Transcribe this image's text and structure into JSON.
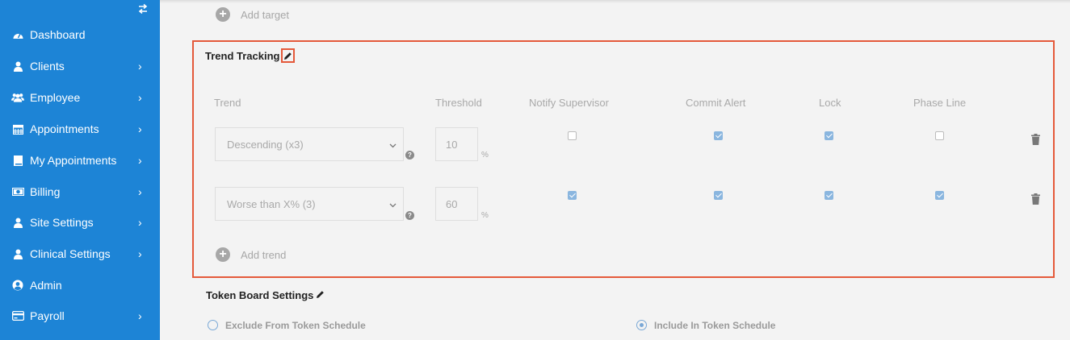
{
  "sidebar": {
    "toggle_icon": "swap-arrows-icon",
    "items": [
      {
        "label": "Dashboard",
        "icon": "tachometer-icon",
        "has_chevron": false
      },
      {
        "label": "Clients",
        "icon": "user-icon",
        "has_chevron": true
      },
      {
        "label": "Employee",
        "icon": "users-icon",
        "has_chevron": true
      },
      {
        "label": "Appointments",
        "icon": "calendar-icon",
        "has_chevron": true
      },
      {
        "label": "My Appointments",
        "icon": "book-icon",
        "has_chevron": true
      },
      {
        "label": "Billing",
        "icon": "money-icon",
        "has_chevron": true
      },
      {
        "label": "Site Settings",
        "icon": "user-icon",
        "has_chevron": true
      },
      {
        "label": "Clinical Settings",
        "icon": "user-icon",
        "has_chevron": true
      },
      {
        "label": "Admin",
        "icon": "user-circle-icon",
        "has_chevron": false
      },
      {
        "label": "Payroll",
        "icon": "credit-card-icon",
        "has_chevron": true
      }
    ],
    "chevron": "›",
    "bg_color": "#1d84d6"
  },
  "targets": {
    "add_label": "Add target"
  },
  "trend_tracking": {
    "title": "Trend Tracking",
    "columns": [
      "Trend",
      "Threshold",
      "Notify Supervisor",
      "Commit Alert",
      "Lock",
      "Phase Line"
    ],
    "rows": [
      {
        "trend": "Descending (x3)",
        "threshold": "10",
        "unit": "%",
        "notify_supervisor": false,
        "commit_alert": true,
        "lock": true,
        "phase_line": false
      },
      {
        "trend": "Worse than X% (3)",
        "threshold": "60",
        "unit": "%",
        "notify_supervisor": true,
        "commit_alert": true,
        "lock": true,
        "phase_line": true
      }
    ],
    "add_label": "Add trend",
    "highlight_color": "#e4593a"
  },
  "token_board": {
    "title": "Token Board Settings",
    "options": [
      {
        "label": "Exclude From Token Schedule",
        "selected": false
      },
      {
        "label": "Include In Token Schedule",
        "selected": true
      }
    ]
  }
}
